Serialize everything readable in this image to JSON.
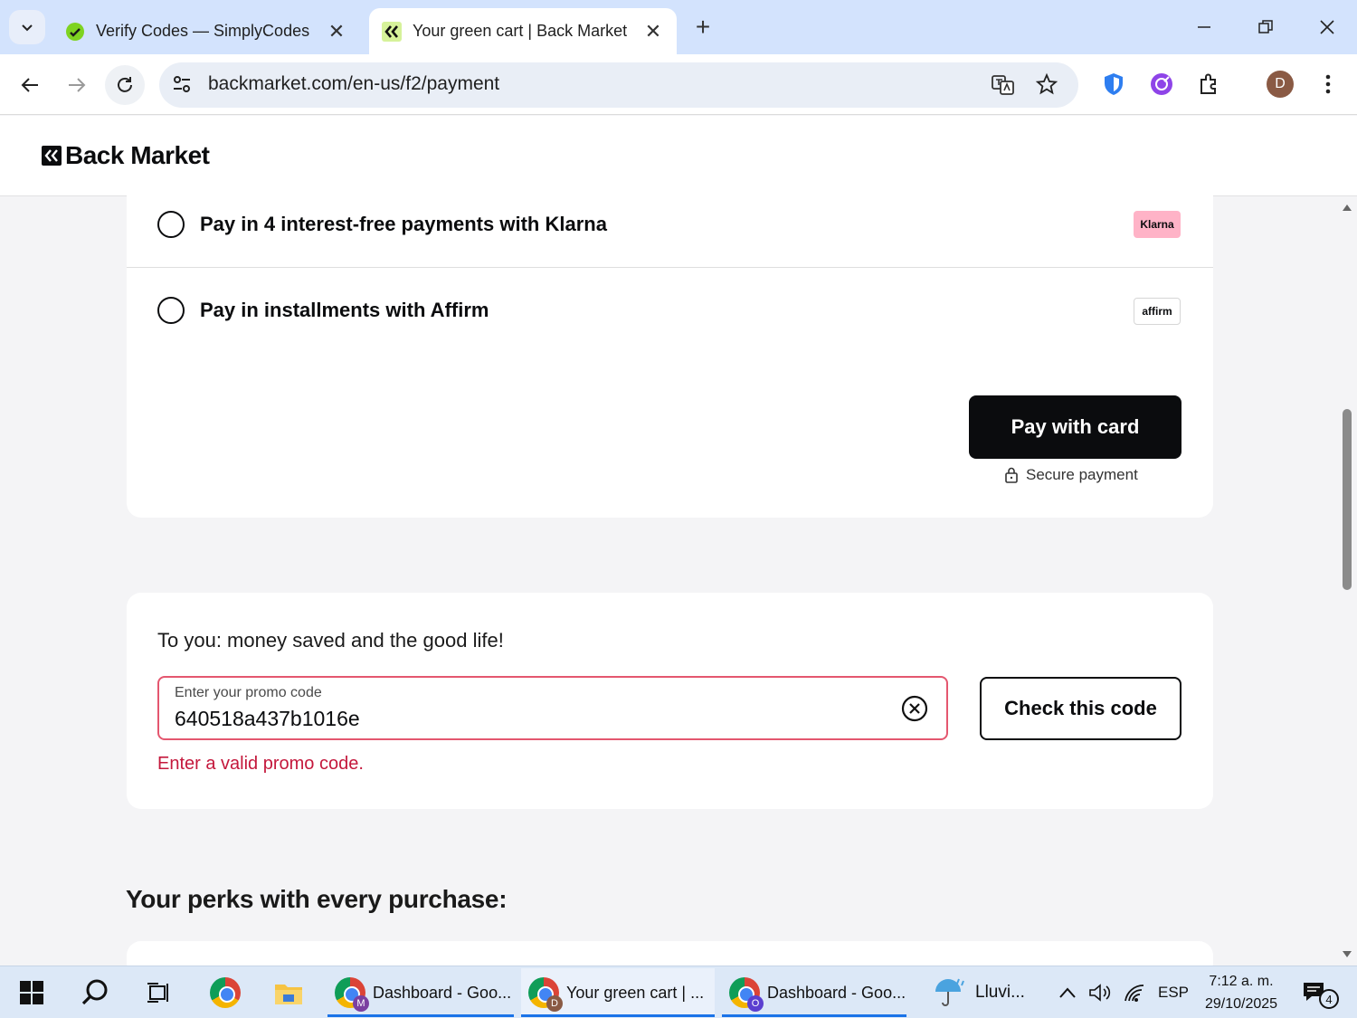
{
  "browser": {
    "tabs": [
      {
        "title": "Verify Codes — SimplyCodes",
        "active": false,
        "favicon": "simplycodes-icon"
      },
      {
        "title": "Your green cart | Back Market",
        "active": true,
        "favicon": "backmarket-icon"
      }
    ],
    "url": "backmarket.com/en-us/f2/payment",
    "profile_initial": "D"
  },
  "site": {
    "logo_text": "Back Market"
  },
  "payment": {
    "options": [
      {
        "label": "Pay in 4 interest-free payments with Klarna",
        "badge": "Klarna",
        "selected": false
      },
      {
        "label": "Pay in installments with Affirm",
        "badge": "affirm",
        "selected": false
      }
    ],
    "pay_button": "Pay with card",
    "secure_label": "Secure payment"
  },
  "promo": {
    "title": "To you: money saved and the good life!",
    "field_label": "Enter your promo code",
    "field_value": "640518a437b1016e",
    "check_button": "Check this code",
    "error": "Enter a valid promo code."
  },
  "perks": {
    "title": "Your perks with every purchase:"
  },
  "taskbar": {
    "apps": [
      {
        "label": "Dashboard - Goo...",
        "profile": "M",
        "profile_color": "#7b3fa0"
      },
      {
        "label": "Your green cart | ...",
        "profile": "D",
        "profile_color": "#8a5a44"
      },
      {
        "label": "Dashboard - Goo...",
        "profile": "O",
        "profile_color": "#5b3fd0"
      }
    ],
    "weather": "Lluvi...",
    "language": "ESP",
    "time": "7:12 a. m.",
    "date": "29/10/2025",
    "notifications": "4"
  },
  "colors": {
    "accent_black": "#0b0c0e",
    "error_red": "#c4183c",
    "klarna_pink": "#ffb3c7",
    "chrome_tab_bg": "#d3e3fd"
  }
}
